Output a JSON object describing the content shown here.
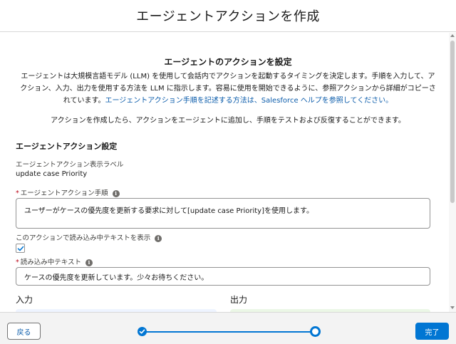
{
  "header": {
    "title": "エージェントアクションを作成"
  },
  "main": {
    "section_title": "エージェントのアクションを設定",
    "intro_text": "エージェントは大規模言語モデル (LLM) を使用して会話内でアクションを起動するタイミングを決定します。手順を入力して、アクション、入力、出力を使用する方法を LLM に指示します。容易に使用を開始できるように、参照アクションから詳細がコピーされています。",
    "intro_link": "エージェントアクション手順を記述する方法は、Salesforce ヘルプを参照してください。",
    "intro_text2": "アクションを作成したら、アクションをエージェントに追加し、手順をテストおよび反復することができます。",
    "settings_heading": "エージェントアクション設定",
    "display_label": {
      "label": "エージェントアクション表示ラベル",
      "value": "update case Priority"
    },
    "instructions": {
      "required_mark": "*",
      "label": "エージェントアクション手順",
      "value": "ユーザーがケースの優先度を更新する要求に対して[update case Priority]を使用します。"
    },
    "show_loading": {
      "label": "このアクションで読み込み中テキストを表示",
      "checked": true
    },
    "loading_text": {
      "required_mark": "*",
      "label": "読み込み中テキスト",
      "value": "ケースの優先度を更新しています。少々お待ちください。"
    },
    "input_heading": "入力",
    "output_heading": "出力",
    "info_icon_glyph": "i"
  },
  "footer": {
    "back_label": "戻る",
    "done_label": "完了",
    "progress_percent": 100
  },
  "colors": {
    "brand": "#0176d3",
    "link": "#0b5cab",
    "required": "#ba0517",
    "input_panel": "#eef4ff",
    "output_panel": "#ebf7e6"
  }
}
